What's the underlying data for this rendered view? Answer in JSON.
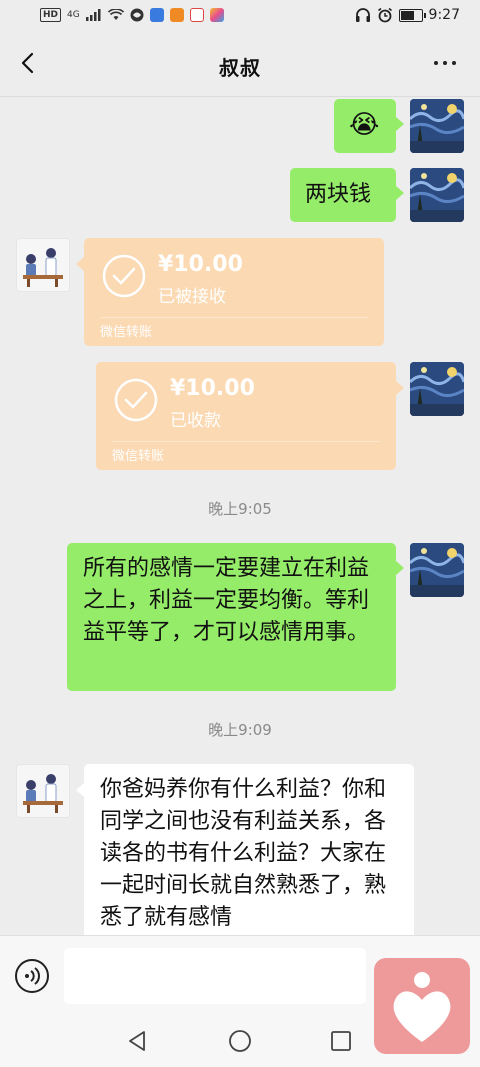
{
  "status_bar": {
    "hd": "HD",
    "network": "4G",
    "time": "9:27",
    "battery_level": 0.6
  },
  "header": {
    "title": "叔叔"
  },
  "messages": {
    "m1": {
      "emoji": "😭"
    },
    "m2": {
      "text": "两块钱"
    },
    "m3": {
      "amount": "¥10.00",
      "status": "已被接收",
      "footer": "微信转账"
    },
    "m4": {
      "amount": "¥10.00",
      "status": "已收款",
      "footer": "微信转账"
    },
    "t1": "晚上9:05",
    "m5": {
      "text": "所有的感情一定要建立在利益之上，利益一定要均衡。等利益平等了，才可以感情用事。"
    },
    "t2": "晚上9:09",
    "m6": {
      "text": "你爸妈养你有什么利益？你和同学之间也没有利益关系，各读各的书有什么利益？大家在一起时间长就自然熟悉了，熟悉了就有感情"
    }
  },
  "colors": {
    "bubble_green": "#95ec69",
    "transfer_orange": "#fbd9b3",
    "chat_background": "#ededed"
  },
  "icons": {
    "back": "chevron-left-icon",
    "more": "more-icon",
    "voice": "voice-icon",
    "emoji": "emoji-icon"
  }
}
